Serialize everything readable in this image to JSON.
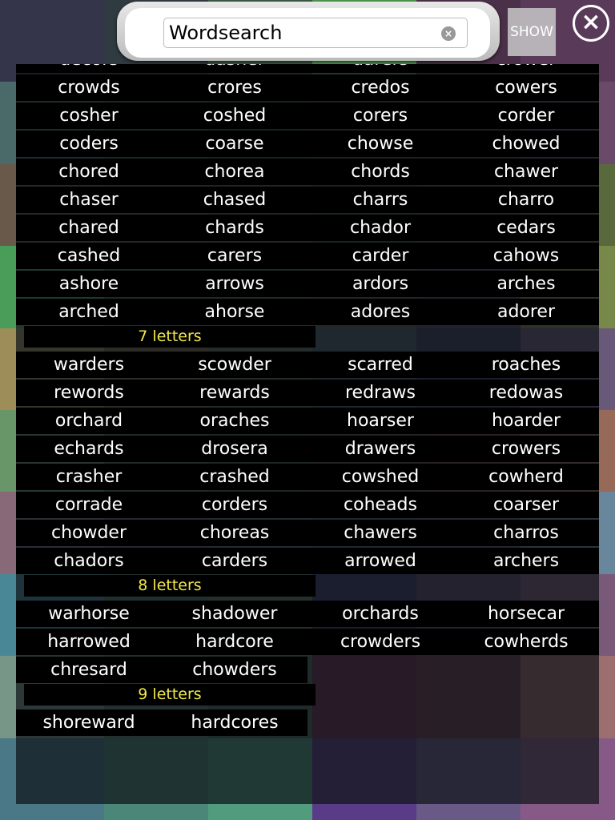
{
  "search": {
    "value": "Wordsearch",
    "show_label": "SHOW"
  },
  "tile_colors": [
    "#33344a",
    "#2d3a40",
    "#3c5b44",
    "#4e9a4e",
    "#4a2e48",
    "#5a3a5a",
    "#4a6b6b",
    "#3a5a5a",
    "#2e4a3e",
    "#3a4a3a",
    "#4a3a4a",
    "#6a4a6a",
    "#6a5a4a",
    "#5a5a3a",
    "#4a5a3a",
    "#3a4a4a",
    "#5a4a3a",
    "#5a6a3a",
    "#4aa05a",
    "#3a6a4a",
    "#4a6a3a",
    "#5a5a4a",
    "#4a4a5a",
    "#7a8a4a",
    "#a0905a",
    "#7a6a4a",
    "#5a6a5a",
    "#4a5a6a",
    "#3a3a5a",
    "#6a5a7a",
    "#6a9a6a",
    "#4a6a5a",
    "#3a5a4a",
    "#5a4a4a",
    "#6a4a3a",
    "#9a6a5a",
    "#8a6a7a",
    "#6a5a6a",
    "#5a6a6a",
    "#4a5a7a",
    "#5a5a6a",
    "#6a8aa0",
    "#4a8a9a",
    "#4a7a6a",
    "#5a7a5a",
    "#3a3a6a",
    "#5a4a6a",
    "#7a5a7a",
    "#7a9a8a",
    "#5a7a6a",
    "#4a6a5a",
    "#6a2a4a",
    "#6a3a4a",
    "#a07070",
    "#4a7a8a",
    "#4a8a7a",
    "#50a080",
    "#5a3a8a",
    "#6a5a8a",
    "#8a5a8a"
  ],
  "partial_row": [
    "decors",
    "dasher",
    "darers",
    "crower"
  ],
  "groups6": [
    [
      "crowds",
      "crores",
      "credos",
      "cowers"
    ],
    [
      "cosher",
      "coshed",
      "corers",
      "corder"
    ],
    [
      "coders",
      "coarse",
      "chowse",
      "chowed"
    ],
    [
      "chored",
      "chorea",
      "chords",
      "chawer"
    ],
    [
      "chaser",
      "chased",
      "charrs",
      "charro"
    ],
    [
      "chared",
      "chards",
      "chador",
      "cedars"
    ],
    [
      "cashed",
      "carers",
      "carder",
      "cahows"
    ],
    [
      "ashore",
      "arrows",
      "ardors",
      "arches"
    ],
    [
      "arched",
      "ahorse",
      "adores",
      "adorer"
    ]
  ],
  "header7": "7 letters",
  "groups7": [
    [
      "warders",
      "scowder",
      "scarred",
      "roaches"
    ],
    [
      "rewords",
      "rewards",
      "redraws",
      "redowas"
    ],
    [
      "orchard",
      "oraches",
      "hoarser",
      "hoarder"
    ],
    [
      "echards",
      "drosera",
      "drawers",
      "crowers"
    ],
    [
      "crasher",
      "crashed",
      "cowshed",
      "cowherd"
    ],
    [
      "corrade",
      "corders",
      "coheads",
      "coarser"
    ],
    [
      "chowder",
      "choreas",
      "chawers",
      "charros"
    ],
    [
      "chadors",
      "carders",
      "arrowed",
      "archers"
    ]
  ],
  "header8": "8 letters",
  "groups8": [
    [
      "warhorse",
      "shadower",
      "orchards",
      "horsecar"
    ],
    [
      "harrowed",
      "hardcore",
      "crowders",
      "cowherds"
    ],
    [
      "chresard",
      "chowders"
    ]
  ],
  "header9": "9 letters",
  "groups9": [
    [
      "shoreward",
      "hardcores"
    ]
  ]
}
